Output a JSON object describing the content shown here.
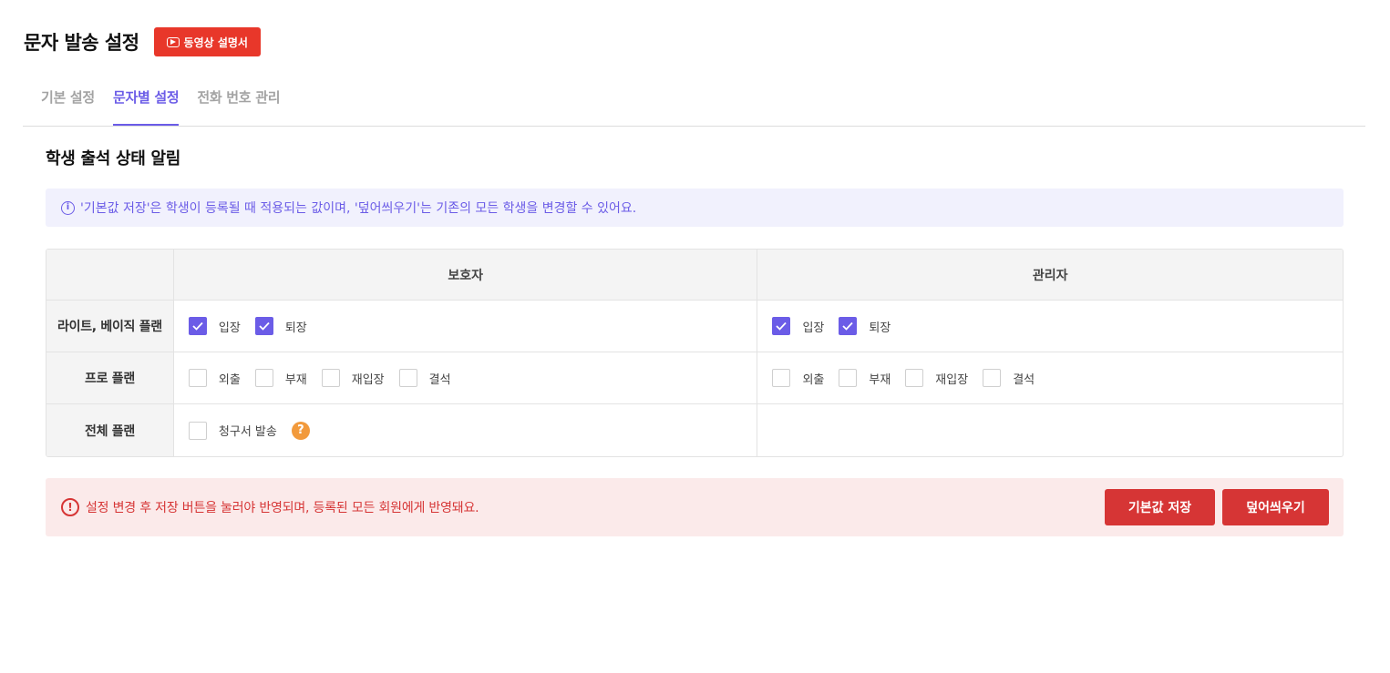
{
  "header": {
    "title": "문자 발송 설정",
    "video_button": "동영상 설명서"
  },
  "tabs": [
    {
      "label": "기본 설정",
      "active": false
    },
    {
      "label": "문자별 설정",
      "active": true
    },
    {
      "label": "전화 번호 관리",
      "active": false
    }
  ],
  "section": {
    "title": "학생 출석 상태 알림",
    "info": "'기본값 저장'은 학생이 등록될 때 적용되는 값이며, '덮어씌우기'는 기존의 모든 학생을 변경할 수 있어요."
  },
  "table": {
    "columns": [
      "보호자",
      "관리자"
    ],
    "rows": [
      {
        "label": "라이트, 베이직 플랜",
        "guardian": [
          {
            "label": "입장",
            "checked": true
          },
          {
            "label": "퇴장",
            "checked": true
          }
        ],
        "admin": [
          {
            "label": "입장",
            "checked": true
          },
          {
            "label": "퇴장",
            "checked": true
          }
        ]
      },
      {
        "label": "프로 플랜",
        "guardian": [
          {
            "label": "외출",
            "checked": false
          },
          {
            "label": "부재",
            "checked": false
          },
          {
            "label": "재입장",
            "checked": false
          },
          {
            "label": "결석",
            "checked": false
          }
        ],
        "admin": [
          {
            "label": "외출",
            "checked": false
          },
          {
            "label": "부재",
            "checked": false
          },
          {
            "label": "재입장",
            "checked": false
          },
          {
            "label": "결석",
            "checked": false
          }
        ]
      },
      {
        "label": "전체 플랜",
        "guardian": [
          {
            "label": "청구서 발송",
            "checked": false
          }
        ],
        "admin": []
      }
    ]
  },
  "footer": {
    "warning": "설정 변경 후 저장 버튼을 눌러야 반영되며, 등록된 모든 회원에게 반영돼요.",
    "save_default": "기본값 저장",
    "overwrite": "덮어씌우기"
  },
  "colors": {
    "accent": "#6b5ce7",
    "danger": "#d63535",
    "video_button": "#e8372a",
    "help": "#f29a3c"
  }
}
